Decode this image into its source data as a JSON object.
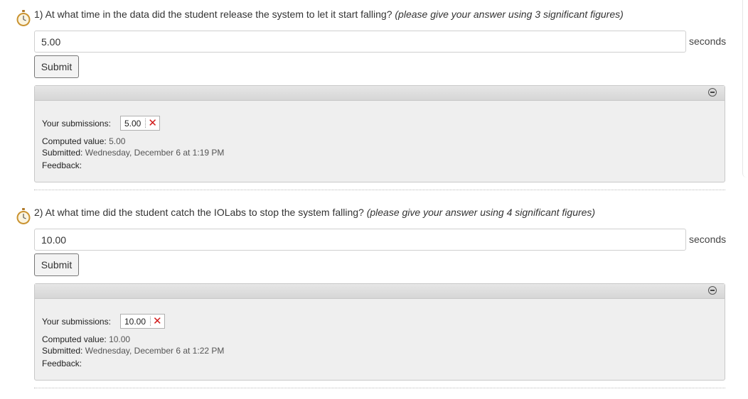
{
  "problems": [
    {
      "question": "1) At what time in the data did the student release the system to let it start falling?",
      "hint": "(please give your answer using 3 significant figures)",
      "answer_value": "5.00",
      "unit": "seconds",
      "submit_label": "Submit",
      "submissions_label": "Your submissions:",
      "submissions": [
        "5.00"
      ],
      "computed_label": "Computed value:",
      "computed_value": "5.00",
      "submitted_label": "Submitted:",
      "submitted_value": "Wednesday, December 6 at 1:19 PM",
      "feedback_label": "Feedback:",
      "feedback_value": ""
    },
    {
      "question": "2) At what time did the student catch the IOLabs to stop the system falling?",
      "hint": "(please give your answer using 4 significant figures)",
      "answer_value": "10.00",
      "unit": "seconds",
      "submit_label": "Submit",
      "submissions_label": "Your submissions:",
      "submissions": [
        "10.00"
      ],
      "computed_label": "Computed value:",
      "computed_value": "10.00",
      "submitted_label": "Submitted:",
      "submitted_value": "Wednesday, December 6 at 1:22 PM",
      "feedback_label": "Feedback:",
      "feedback_value": ""
    }
  ],
  "icons": {
    "timer": "stopwatch-icon",
    "incorrect": "x-mark-icon",
    "collapse": "minus-circle-icon"
  },
  "colors": {
    "incorrect_mark": "#d11a1a",
    "panel_bg": "#efefef"
  }
}
